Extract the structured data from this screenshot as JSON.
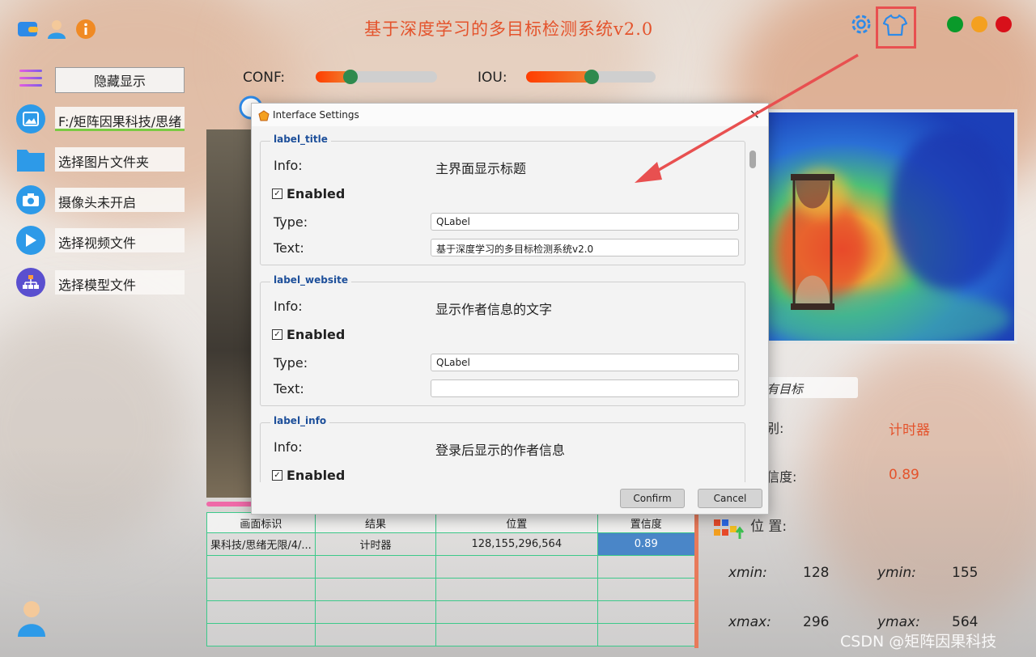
{
  "app": {
    "title": "基于深度学习的多目标检测系统v2.0",
    "colors": {
      "accent": "#e4532c",
      "dot_green": "#0a9a2a",
      "dot_yellow": "#f4a020",
      "dot_red": "#d8101a",
      "highlight_box": "#e85050"
    }
  },
  "sidebar": {
    "toggle_label": "隐藏显示",
    "items": [
      {
        "icon": "image-icon",
        "label": "F:/矩阵因果科技/思绪"
      },
      {
        "icon": "folder-icon",
        "label": "选择图片文件夹"
      },
      {
        "icon": "camera-icon",
        "label": "摄像头未开启"
      },
      {
        "icon": "play-icon",
        "label": "选择视频文件"
      },
      {
        "icon": "model-icon",
        "label": "选择模型文件"
      }
    ]
  },
  "sliders": {
    "conf": {
      "label": "CONF:",
      "value": 0.3
    },
    "iou": {
      "label": "IOU:",
      "value": 0.55
    }
  },
  "results": {
    "target_select": "有目标",
    "class_label": "别:",
    "class_value": "计时器",
    "conf_label": "信度:",
    "conf_value": "0.89",
    "position_label": "位 置:",
    "xmin_label": "xmin:",
    "xmin": "128",
    "ymin_label": "ymin:",
    "ymin": "155",
    "xmax_label": "xmax:",
    "xmax": "296",
    "ymax_label": "ymax:",
    "ymax": "564"
  },
  "table": {
    "headers": [
      "画面标识",
      "结果",
      "位置",
      "置信度"
    ],
    "rows": [
      [
        "果科技/思绪无限/4/...",
        "计时器",
        "128,155,296,564",
        "0.89"
      ]
    ]
  },
  "dialog": {
    "title": "Interface Settings",
    "groups": [
      {
        "name": "label_title",
        "info_label": "Info:",
        "info": "主界面显示标题",
        "enabled_label": "Enabled",
        "type_label": "Type:",
        "type": "QLabel",
        "text_label": "Text:",
        "text": "基于深度学习的多目标检测系统v2.0"
      },
      {
        "name": "label_website",
        "info_label": "Info:",
        "info": "显示作者信息的文字",
        "enabled_label": "Enabled",
        "type_label": "Type:",
        "type": "QLabel",
        "text_label": "Text:",
        "text": ""
      },
      {
        "name": "label_info",
        "info_label": "Info:",
        "info": "登录后显示的作者信息",
        "enabled_label": "Enabled"
      }
    ],
    "confirm_label": "Confirm",
    "cancel_label": "Cancel"
  },
  "watermark": "CSDN @矩阵因果科技"
}
